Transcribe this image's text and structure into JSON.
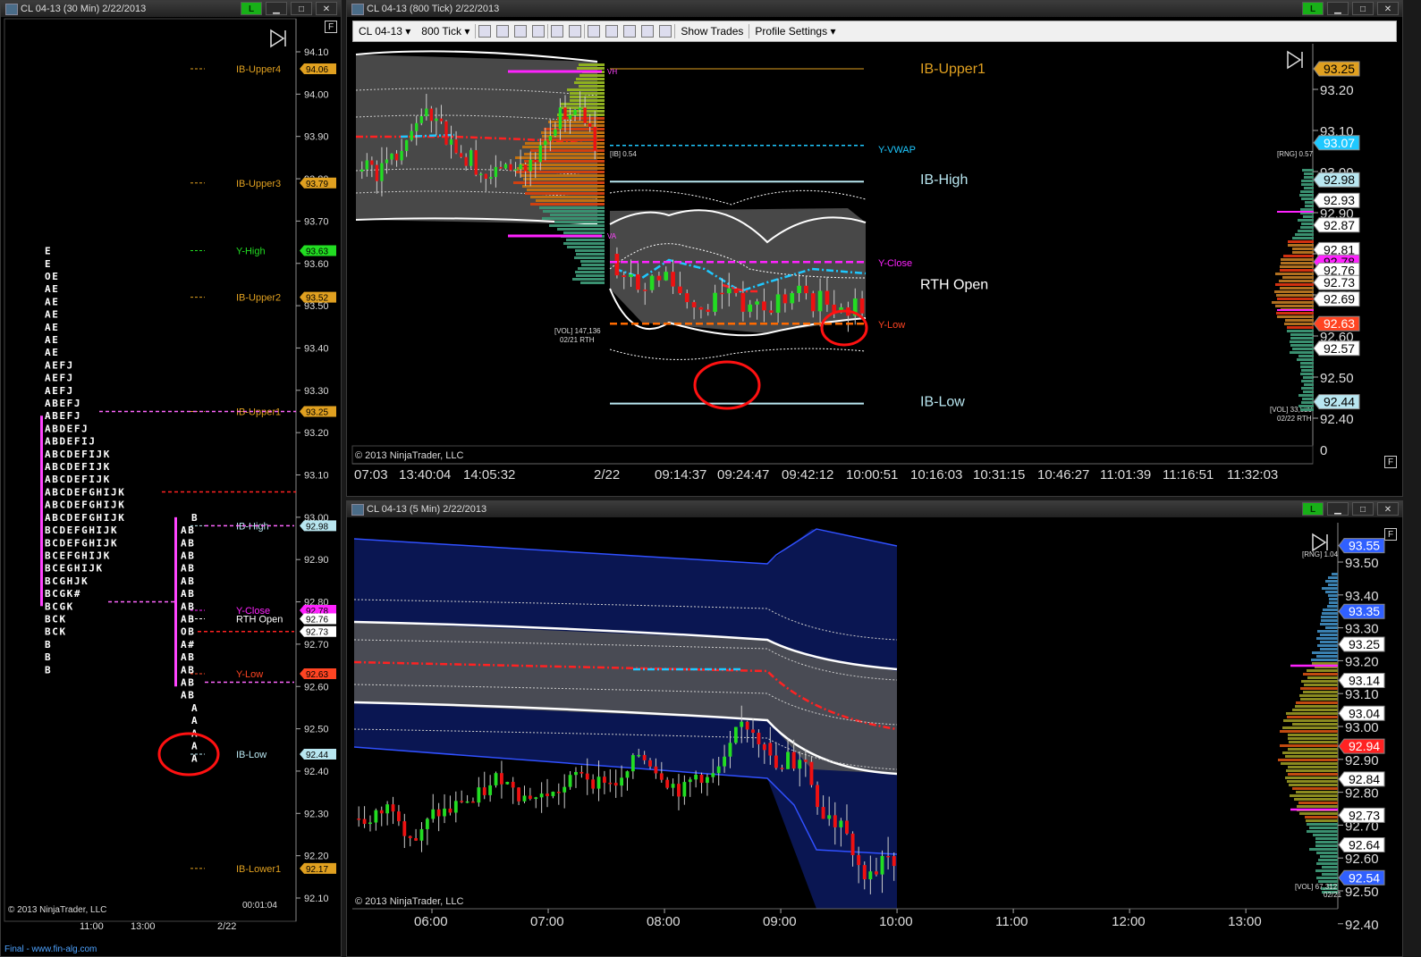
{
  "windows": {
    "tpo": {
      "title": "CL 04-13 (30 Min)  2/22/2013",
      "copyright": "© 2013 NinjaTrader, LLC",
      "timer": "00:01:04",
      "status": "Final - www.fin-alg.com",
      "x_labels": [
        "11:00",
        "13:00",
        "2/22"
      ]
    },
    "tick": {
      "title": "CL 04-13 (800 Tick)  2/22/2013",
      "copyright": "© 2013 NinjaTrader, LLC",
      "toolbar": {
        "instrument": "CL 04-13",
        "interval": "800 Tick",
        "show_trades": "Show Trades",
        "profile_settings": "Profile Settings"
      },
      "x_labels": [
        "07:03",
        "13:40:04",
        "14:05:32",
        "2/22",
        "09:14:37",
        "09:24:47",
        "09:42:12",
        "10:00:51",
        "10:16:03",
        "10:31:15",
        "10:46:27",
        "11:01:39",
        "11:16:51",
        "11:32:03"
      ],
      "notes": [
        "[IB] 0.54",
        "[VOL] 147,136",
        "02/21 RTH",
        "[RNG] 0.57",
        "[VOL] 33,529",
        "02/22 RTH",
        "VH",
        "VA"
      ]
    },
    "five": {
      "title": "CL 04-13 (5 Min)  2/22/2013",
      "copyright": "© 2013 NinjaTrader, LLC",
      "x_labels": [
        "06:00",
        "07:00",
        "08:00",
        "09:00",
        "10:00",
        "11:00",
        "12:00",
        "13:00"
      ],
      "notes": [
        "[RNG] 1.04",
        "[VOL] 67,312",
        "02/21"
      ]
    }
  },
  "colors": {
    "up": "#22dd22",
    "down": "#ee1111",
    "vwap": "#1ec8ff",
    "vah_val": "#ff22ff",
    "ib": "#b8e6f0",
    "orange": "#ff6a00"
  },
  "chart_data": [
    {
      "type": "table",
      "title": "",
      "price_axis": [
        "94.10",
        "94.00",
        "93.90",
        "93.80",
        "93.70",
        "93.60",
        "93.50",
        "93.40",
        "93.30",
        "93.20",
        "93.10",
        "93.00",
        "92.90",
        "92.80",
        "92.70",
        "92.60",
        "92.50",
        "92.40",
        "92.30",
        "92.20",
        "92.10"
      ],
      "levels": [
        {
          "name": "IB-Upper4",
          "price": "94.06",
          "color": "#e0a020"
        },
        {
          "name": "IB-Upper3",
          "price": "93.79",
          "color": "#e0a020"
        },
        {
          "name": "Y-High",
          "price": "93.63",
          "color": "#22dd22"
        },
        {
          "name": "IB-Upper2",
          "price": "93.52",
          "color": "#e0a020"
        },
        {
          "name": "IB-Upper1",
          "price": "93.25",
          "color": "#e0a020"
        },
        {
          "name": "IB-High",
          "price": "92.98",
          "color": "#b8e6f0"
        },
        {
          "name": "Y-Close",
          "price": "92.78",
          "color": "#ff22ff"
        },
        {
          "name": "RTH Open",
          "price": "92.76",
          "color": "#ffffff"
        },
        {
          "name": "",
          "price": "92.73",
          "color": "#ffffff"
        },
        {
          "name": "Y-Low",
          "price": "92.63",
          "color": "#ff4422"
        },
        {
          "name": "IB-Low",
          "price": "92.44",
          "color": "#b8e6f0"
        },
        {
          "name": "IB-Lower1",
          "price": "92.17",
          "color": "#e0a020"
        }
      ],
      "tpo_yesterday": [
        "E",
        "E",
        "OE",
        "AE",
        "AE",
        "AE",
        "AE",
        "AE",
        "AE",
        "AEFJ",
        "AEFJ",
        "AEFJ",
        "ABEFJ",
        "ABEFJ",
        "ABDEFJ",
        "ABDEFIJ",
        "ABCDEFIJK",
        "ABCDEFIJK",
        "ABCDEFIJK",
        "ABCDEFGHIJK",
        "ABCDEFGHIJK",
        "ABCDEFGHIJK",
        "BCDEFGHIJK",
        "BCDEFGHIJK",
        "BCEFGHIJK",
        "BCEGHIJK",
        "BCGHJK",
        "BCGK#",
        "BCGK",
        "BCK",
        "BCK",
        "B",
        "B",
        "B"
      ],
      "tpo_today": [
        "B",
        "AB",
        "AB",
        "AB",
        "AB",
        "AB",
        "AB",
        "AB",
        "AB",
        "OB",
        "A#",
        "AB",
        "AB",
        "AB",
        "AB",
        "A",
        "A",
        "A",
        "A",
        "A"
      ]
    },
    {
      "type": "line",
      "title": "",
      "price_axis": [
        "93.20",
        "93.10",
        "93.00",
        "92.90",
        "92.80",
        "92.70",
        "92.60",
        "92.50",
        "92.40"
      ],
      "level_labels": [
        {
          "name": "IB-Upper1",
          "price": "93.25"
        },
        {
          "name": "Y-VWAP",
          "price": "93.07"
        },
        {
          "name": "IB-High",
          "price": "92.98"
        },
        {
          "name": "Y-Close",
          "price": "92.78"
        },
        {
          "name": "RTH Open",
          "price": "92.76"
        },
        {
          "name": "Y-Low",
          "price": "92.63"
        },
        {
          "name": "IB-Low",
          "price": "92.44"
        }
      ],
      "price_tags": [
        "93.25",
        "93.07",
        "92.98",
        "92.93",
        "92.87",
        "92.81",
        "92.78",
        "92.76",
        "92.73",
        "92.69",
        "92.63",
        "92.57",
        "92.44"
      ],
      "zero_label": "0"
    },
    {
      "type": "line",
      "title": "",
      "price_axis": [
        "93.50",
        "93.40",
        "93.30",
        "93.20",
        "93.10",
        "93.00",
        "92.90",
        "92.80",
        "92.70",
        "92.60",
        "92.50",
        "92.40"
      ],
      "price_tags": [
        "93.55",
        "93.35",
        "93.25",
        "93.14",
        "93.04",
        "92.94",
        "92.84",
        "92.73",
        "92.64",
        "92.54"
      ],
      "y_range": [
        92.35,
        93.6
      ],
      "x_range": [
        "05:25",
        "13:50"
      ]
    }
  ]
}
